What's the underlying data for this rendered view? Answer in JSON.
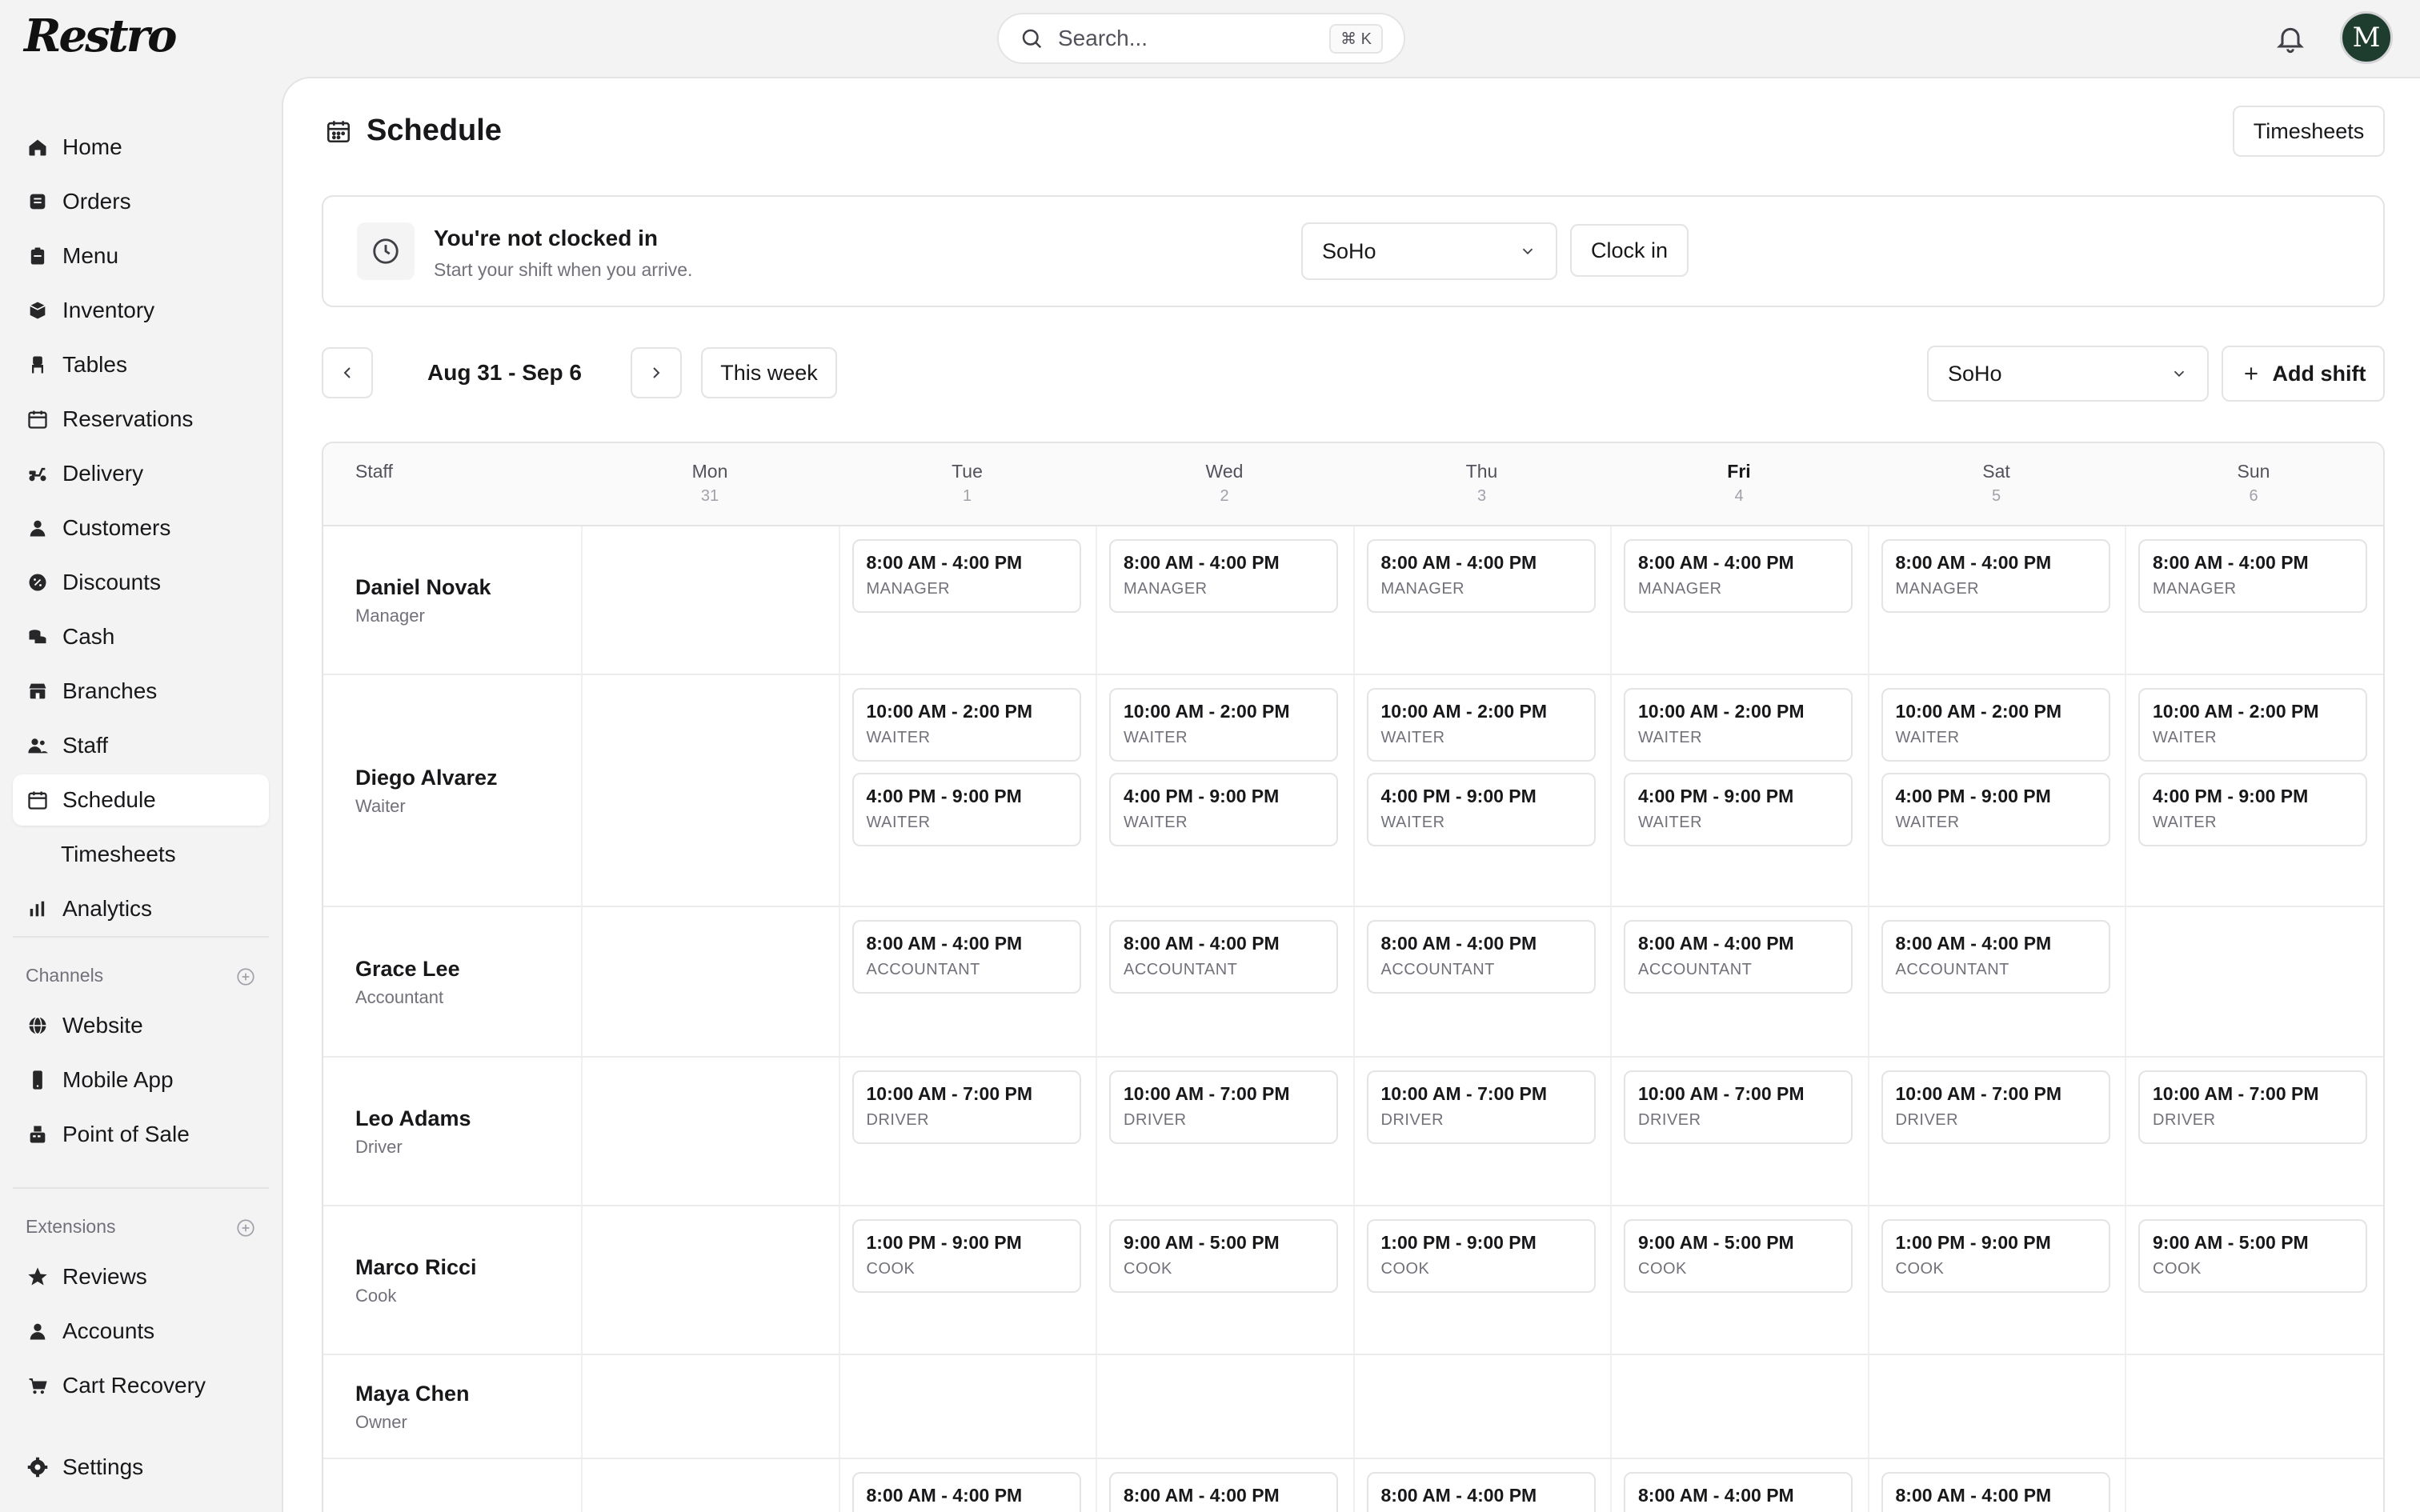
{
  "app": {
    "logo": "Restro",
    "search_placeholder": "Search...",
    "search_shortcut": "⌘ K",
    "avatar_initial": "M"
  },
  "sidebar": {
    "items": [
      {
        "label": "Home",
        "icon": "home-icon"
      },
      {
        "label": "Orders",
        "icon": "orders-icon"
      },
      {
        "label": "Menu",
        "icon": "menu-icon"
      },
      {
        "label": "Inventory",
        "icon": "inventory-icon"
      },
      {
        "label": "Tables",
        "icon": "chair-icon"
      },
      {
        "label": "Reservations",
        "icon": "calendar-icon"
      },
      {
        "label": "Delivery",
        "icon": "scooter-icon"
      },
      {
        "label": "Customers",
        "icon": "user-icon"
      },
      {
        "label": "Discounts",
        "icon": "discount-icon"
      },
      {
        "label": "Cash",
        "icon": "cash-icon"
      },
      {
        "label": "Branches",
        "icon": "store-icon"
      },
      {
        "label": "Staff",
        "icon": "staff-icon"
      },
      {
        "label": "Schedule",
        "icon": "calendar-icon",
        "active": true
      },
      {
        "label": "Timesheets",
        "sub": true
      },
      {
        "label": "Analytics",
        "icon": "chart-icon"
      }
    ],
    "channels_label": "Channels",
    "channels": [
      {
        "label": "Website",
        "icon": "globe-icon"
      },
      {
        "label": "Mobile App",
        "icon": "phone-icon"
      },
      {
        "label": "Point of Sale",
        "icon": "pos-icon"
      }
    ],
    "extensions_label": "Extensions",
    "extensions": [
      {
        "label": "Reviews",
        "icon": "star-icon"
      },
      {
        "label": "Accounts",
        "icon": "user-icon"
      },
      {
        "label": "Cart Recovery",
        "icon": "cart-icon"
      }
    ],
    "settings_label": "Settings"
  },
  "page": {
    "title": "Schedule",
    "timesheets_button": "Timesheets"
  },
  "clock": {
    "title": "You're not clocked in",
    "subtitle": "Start your shift when you arrive.",
    "branch": "SoHo",
    "button": "Clock in"
  },
  "week": {
    "range": "Aug 31 - Sep 6",
    "this_week_button": "This week",
    "branch": "SoHo",
    "add_shift_button": "Add shift"
  },
  "grid": {
    "staff_header": "Staff",
    "days": [
      {
        "name": "Mon",
        "num": "31"
      },
      {
        "name": "Tue",
        "num": "1"
      },
      {
        "name": "Wed",
        "num": "2"
      },
      {
        "name": "Thu",
        "num": "3"
      },
      {
        "name": "Fri",
        "num": "4",
        "today": true
      },
      {
        "name": "Sat",
        "num": "5"
      },
      {
        "name": "Sun",
        "num": "6"
      }
    ],
    "rows": [
      {
        "name": "Daniel Novak",
        "role": "Manager",
        "shifts": [
          [],
          [
            {
              "time": "8:00 AM - 4:00 PM",
              "role": "MANAGER"
            }
          ],
          [
            {
              "time": "8:00 AM - 4:00 PM",
              "role": "MANAGER"
            }
          ],
          [
            {
              "time": "8:00 AM - 4:00 PM",
              "role": "MANAGER"
            }
          ],
          [
            {
              "time": "8:00 AM - 4:00 PM",
              "role": "MANAGER"
            }
          ],
          [
            {
              "time": "8:00 AM - 4:00 PM",
              "role": "MANAGER"
            }
          ],
          [
            {
              "time": "8:00 AM - 4:00 PM",
              "role": "MANAGER"
            }
          ]
        ]
      },
      {
        "name": "Diego Alvarez",
        "role": "Waiter",
        "shifts": [
          [],
          [
            {
              "time": "10:00 AM - 2:00 PM",
              "role": "WAITER"
            },
            {
              "time": "4:00 PM - 9:00 PM",
              "role": "WAITER"
            }
          ],
          [
            {
              "time": "10:00 AM - 2:00 PM",
              "role": "WAITER"
            },
            {
              "time": "4:00 PM - 9:00 PM",
              "role": "WAITER"
            }
          ],
          [
            {
              "time": "10:00 AM - 2:00 PM",
              "role": "WAITER"
            },
            {
              "time": "4:00 PM - 9:00 PM",
              "role": "WAITER"
            }
          ],
          [
            {
              "time": "10:00 AM - 2:00 PM",
              "role": "WAITER"
            },
            {
              "time": "4:00 PM - 9:00 PM",
              "role": "WAITER"
            }
          ],
          [
            {
              "time": "10:00 AM - 2:00 PM",
              "role": "WAITER"
            },
            {
              "time": "4:00 PM - 9:00 PM",
              "role": "WAITER"
            }
          ],
          [
            {
              "time": "10:00 AM - 2:00 PM",
              "role": "WAITER"
            },
            {
              "time": "4:00 PM - 9:00 PM",
              "role": "WAITER"
            }
          ]
        ]
      },
      {
        "name": "Grace Lee",
        "role": "Accountant",
        "shifts": [
          [],
          [
            {
              "time": "8:00 AM - 4:00 PM",
              "role": "ACCOUNTANT"
            }
          ],
          [
            {
              "time": "8:00 AM - 4:00 PM",
              "role": "ACCOUNTANT"
            }
          ],
          [
            {
              "time": "8:00 AM - 4:00 PM",
              "role": "ACCOUNTANT"
            }
          ],
          [
            {
              "time": "8:00 AM - 4:00 PM",
              "role": "ACCOUNTANT"
            }
          ],
          [
            {
              "time": "8:00 AM - 4:00 PM",
              "role": "ACCOUNTANT"
            }
          ],
          []
        ]
      },
      {
        "name": "Leo Adams",
        "role": "Driver",
        "shifts": [
          [],
          [
            {
              "time": "10:00 AM - 7:00 PM",
              "role": "DRIVER"
            }
          ],
          [
            {
              "time": "10:00 AM - 7:00 PM",
              "role": "DRIVER"
            }
          ],
          [
            {
              "time": "10:00 AM - 7:00 PM",
              "role": "DRIVER"
            }
          ],
          [
            {
              "time": "10:00 AM - 7:00 PM",
              "role": "DRIVER"
            }
          ],
          [
            {
              "time": "10:00 AM - 7:00 PM",
              "role": "DRIVER"
            }
          ],
          [
            {
              "time": "10:00 AM - 7:00 PM",
              "role": "DRIVER"
            }
          ]
        ]
      },
      {
        "name": "Marco Ricci",
        "role": "Cook",
        "shifts": [
          [],
          [
            {
              "time": "1:00 PM - 9:00 PM",
              "role": "COOK"
            }
          ],
          [
            {
              "time": "9:00 AM - 5:00 PM",
              "role": "COOK"
            }
          ],
          [
            {
              "time": "1:00 PM - 9:00 PM",
              "role": "COOK"
            }
          ],
          [
            {
              "time": "9:00 AM - 5:00 PM",
              "role": "COOK"
            }
          ],
          [
            {
              "time": "1:00 PM - 9:00 PM",
              "role": "COOK"
            }
          ],
          [
            {
              "time": "9:00 AM - 5:00 PM",
              "role": "COOK"
            }
          ]
        ]
      },
      {
        "name": "Maya Chen",
        "role": "Owner",
        "shifts": [
          [],
          [],
          [],
          [],
          [],
          [],
          []
        ]
      },
      {
        "name": "",
        "role": "",
        "shifts": [
          [],
          [
            {
              "time": "8:00 AM - 4:00 PM",
              "role": ""
            }
          ],
          [
            {
              "time": "8:00 AM - 4:00 PM",
              "role": ""
            }
          ],
          [
            {
              "time": "8:00 AM - 4:00 PM",
              "role": ""
            }
          ],
          [
            {
              "time": "8:00 AM - 4:00 PM",
              "role": ""
            }
          ],
          [
            {
              "time": "8:00 AM - 4:00 PM",
              "role": ""
            }
          ],
          []
        ]
      }
    ]
  }
}
